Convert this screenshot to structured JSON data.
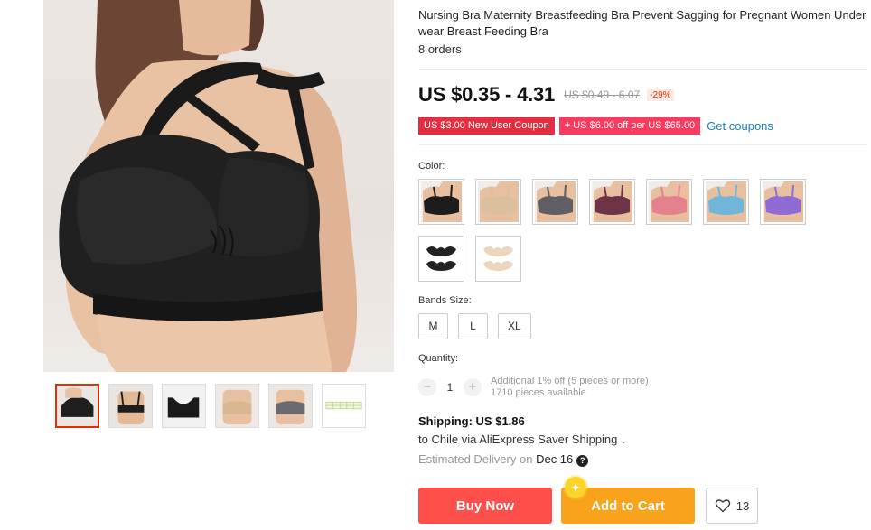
{
  "product": {
    "title": "Nursing Bra Maternity Breastfeeding Bra Prevent Sagging for Pregnant Women Underwear Breast Feeding Bra",
    "orders": "8 orders"
  },
  "price": {
    "current": "US $0.35 - 4.31",
    "original": "US $0.49 - 6.07",
    "discount": "-29%"
  },
  "coupons": {
    "new_user": "US $3.00 New User Coupon",
    "store_plus": "+",
    "store": "US $6.00 off per US $65.00",
    "get_link": "Get coupons"
  },
  "color": {
    "label": "Color:",
    "options": [
      {
        "name": "Black",
        "hex": "#1c1c1c"
      },
      {
        "name": "Beige",
        "hex": "#dcbf9c"
      },
      {
        "name": "Gray",
        "hex": "#5e5e63"
      },
      {
        "name": "Wine",
        "hex": "#6e3347"
      },
      {
        "name": "Pink",
        "hex": "#e4818e"
      },
      {
        "name": "Sky Blue",
        "hex": "#6fb6d8"
      },
      {
        "name": "Purple",
        "hex": "#8f6bd6"
      },
      {
        "name": "Black Pads",
        "hex": "#222222"
      },
      {
        "name": "Beige Pads",
        "hex": "#ecd6bd"
      }
    ]
  },
  "bands": {
    "label": "Bands Size:",
    "sizes": [
      "M",
      "L",
      "XL"
    ]
  },
  "quantity": {
    "label": "Quantity:",
    "minus": "−",
    "value": "1",
    "plus": "+",
    "note1": "Additional 1% off (5 pieces or more)",
    "note2": "1710 pieces available"
  },
  "shipping": {
    "title": "Shipping: US $1.86",
    "to": "to Chile via AliExpress Saver Shipping",
    "chev": "⌄",
    "delivery_prefix": "Estimated Delivery on",
    "delivery_date": "Dec 16",
    "help": "?"
  },
  "actions": {
    "buy_now": "Buy Now",
    "add_to_cart": "Add to Cart",
    "cart_badge": "✦",
    "wishlist_count": "13"
  },
  "colors": {
    "accent_red": "#fe4f4d",
    "cart_orange": "#f9a21c",
    "coupon_red": "#e62e40",
    "link_blue": "#1a7fc4"
  }
}
